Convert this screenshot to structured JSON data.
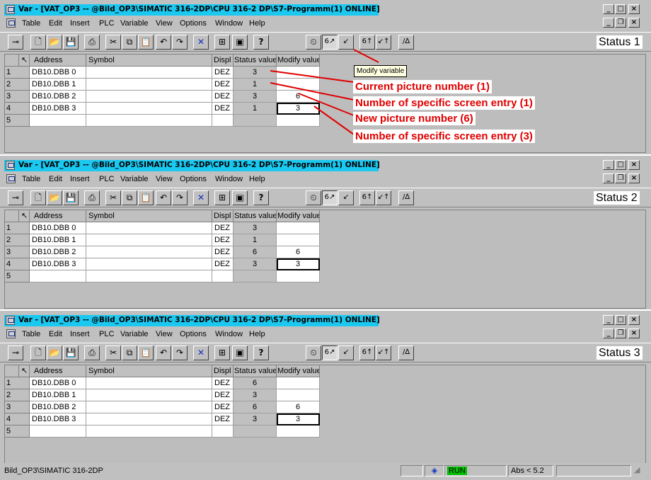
{
  "window": {
    "title": "Var - [VAT_OP3 -- @Bild_OP3\\SIMATIC 316-2DP\\CPU 316-2 DP\\S7-Programm(1)  ONLINE]"
  },
  "window_buttons": [
    "_",
    "□",
    "×"
  ],
  "doc_buttons": [
    "_",
    "❐",
    "×"
  ],
  "menu": {
    "items": [
      "Table",
      "Edit",
      "Insert",
      "PLC",
      "Variable",
      "View",
      "Options",
      "Window",
      "Help"
    ]
  },
  "table": {
    "headers": [
      "Address",
      "Symbol",
      "Displ",
      "Status value",
      "Modify value"
    ]
  },
  "panels": [
    {
      "status_label": "Status 1",
      "rows": [
        {
          "num": "1",
          "address": "DB10.DBB   0",
          "symbol": "",
          "display": "DEZ",
          "status": "3",
          "modify": ""
        },
        {
          "num": "2",
          "address": "DB10.DBB   1",
          "symbol": "",
          "display": "DEZ",
          "status": "1",
          "modify": ""
        },
        {
          "num": "3",
          "address": "DB10.DBB   2",
          "symbol": "",
          "display": "DEZ",
          "status": "3",
          "modify": "6"
        },
        {
          "num": "4",
          "address": "DB10.DBB   3",
          "symbol": "",
          "display": "DEZ",
          "status": "1",
          "modify": "3"
        },
        {
          "num": "5",
          "address": "",
          "symbol": "",
          "display": "",
          "status": "",
          "modify": ""
        }
      ]
    },
    {
      "status_label": "Status 2",
      "rows": [
        {
          "num": "1",
          "address": "DB10.DBB   0",
          "symbol": "",
          "display": "DEZ",
          "status": "3",
          "modify": ""
        },
        {
          "num": "2",
          "address": "DB10.DBB   1",
          "symbol": "",
          "display": "DEZ",
          "status": "1",
          "modify": ""
        },
        {
          "num": "3",
          "address": "DB10.DBB   2",
          "symbol": "",
          "display": "DEZ",
          "status": "6",
          "modify": "6"
        },
        {
          "num": "4",
          "address": "DB10.DBB   3",
          "symbol": "",
          "display": "DEZ",
          "status": "3",
          "modify": "3"
        },
        {
          "num": "5",
          "address": "",
          "symbol": "",
          "display": "",
          "status": "",
          "modify": ""
        }
      ]
    },
    {
      "status_label": "Status 3",
      "rows": [
        {
          "num": "1",
          "address": "DB10.DBB   0",
          "symbol": "",
          "display": "DEZ",
          "status": "6",
          "modify": ""
        },
        {
          "num": "2",
          "address": "DB10.DBB   1",
          "symbol": "",
          "display": "DEZ",
          "status": "3",
          "modify": ""
        },
        {
          "num": "3",
          "address": "DB10.DBB   2",
          "symbol": "",
          "display": "DEZ",
          "status": "6",
          "modify": "6"
        },
        {
          "num": "4",
          "address": "DB10.DBB   3",
          "symbol": "",
          "display": "DEZ",
          "status": "3",
          "modify": "3"
        },
        {
          "num": "5",
          "address": "",
          "symbol": "",
          "display": "",
          "status": "",
          "modify": ""
        }
      ]
    }
  ],
  "annotations": {
    "tooltip": "Modify variable",
    "labels": [
      "Current picture number (1)",
      "Number of specific screen entry (1)",
      "New picture number (6)",
      "Number of specific screen entry (3)"
    ],
    "color": "#e00000"
  },
  "toolbar_icons": [
    {
      "name": "pin-icon",
      "glyph": "⊸"
    },
    {
      "name": "new-icon",
      "glyph": "🗋"
    },
    {
      "name": "open-icon",
      "glyph": "📂"
    },
    {
      "name": "save-icon",
      "glyph": "💾"
    },
    {
      "name": "print-icon",
      "glyph": "⎙"
    },
    {
      "name": "cut-icon",
      "glyph": "✂"
    },
    {
      "name": "copy-icon",
      "glyph": "⧉"
    },
    {
      "name": "paste-icon",
      "glyph": "📋"
    },
    {
      "name": "undo-icon",
      "glyph": "↶"
    },
    {
      "name": "redo-icon",
      "glyph": "↷"
    },
    {
      "name": "delete-icon",
      "glyph": "✕"
    },
    {
      "name": "online-icon",
      "glyph": "⊞"
    },
    {
      "name": "monitor-icon",
      "glyph": "▣"
    },
    {
      "name": "help-icon",
      "glyph": "?"
    },
    {
      "name": "trigger-icon",
      "glyph": "⏲"
    },
    {
      "name": "monitor-variable-icon",
      "glyph": "6↗"
    },
    {
      "name": "modify-variable-icon",
      "glyph": "↙"
    },
    {
      "name": "update-monitor-icon",
      "glyph": "6↑"
    },
    {
      "name": "activate-modify-icon",
      "glyph": "↙↑"
    },
    {
      "name": "force-icon",
      "glyph": "/∆"
    }
  ],
  "statusbar": {
    "path": "Bild_OP3\\SIMATIC 316-2DP",
    "run_state": "RUN",
    "abs": "Abs < 5.2",
    "run_color": "#00c000"
  }
}
